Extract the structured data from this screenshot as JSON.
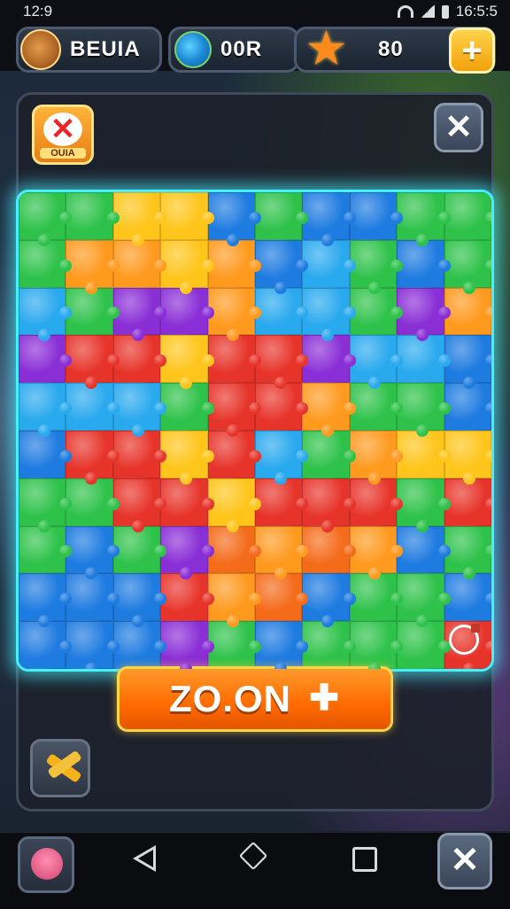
{
  "status": {
    "time": "12:9",
    "clock_right": "16:5:5"
  },
  "hud": {
    "profile_name": "BEUIA",
    "coins_value": "00R",
    "stars_value": "80",
    "plus_label": "+"
  },
  "panel": {
    "badge_text": "OUIA",
    "close_symbol": "✕"
  },
  "zoom_button": {
    "label": "ZO.ON",
    "icon": "plus-icon"
  },
  "colors": {
    "puzzle": [
      "#2ec24a",
      "#ff9a1f",
      "#ffc51a",
      "#1e7be0",
      "#e7342a",
      "#8a2ed6",
      "#29a9ee",
      "#f46b1a"
    ],
    "board_glow": "#46f0ff",
    "zoom_button": "#ff7a00"
  },
  "puzzle_pieces": [
    [
      0,
      0,
      2,
      2,
      3,
      0,
      3,
      3,
      0,
      0
    ],
    [
      0,
      1,
      1,
      2,
      1,
      3,
      6,
      0,
      3,
      0
    ],
    [
      6,
      0,
      5,
      5,
      1,
      6,
      6,
      0,
      5,
      1
    ],
    [
      5,
      4,
      4,
      2,
      4,
      4,
      5,
      6,
      6,
      3
    ],
    [
      6,
      6,
      6,
      0,
      4,
      4,
      1,
      0,
      0,
      3
    ],
    [
      3,
      4,
      4,
      2,
      4,
      6,
      0,
      1,
      2,
      2
    ],
    [
      0,
      0,
      4,
      4,
      2,
      4,
      4,
      4,
      0,
      4
    ],
    [
      0,
      3,
      0,
      5,
      7,
      1,
      7,
      1,
      3,
      0
    ],
    [
      3,
      3,
      3,
      4,
      1,
      7,
      3,
      0,
      0,
      3
    ],
    [
      3,
      3,
      3,
      5,
      0,
      3,
      0,
      0,
      0,
      4
    ]
  ],
  "nav": {
    "close_symbol": "✕"
  }
}
